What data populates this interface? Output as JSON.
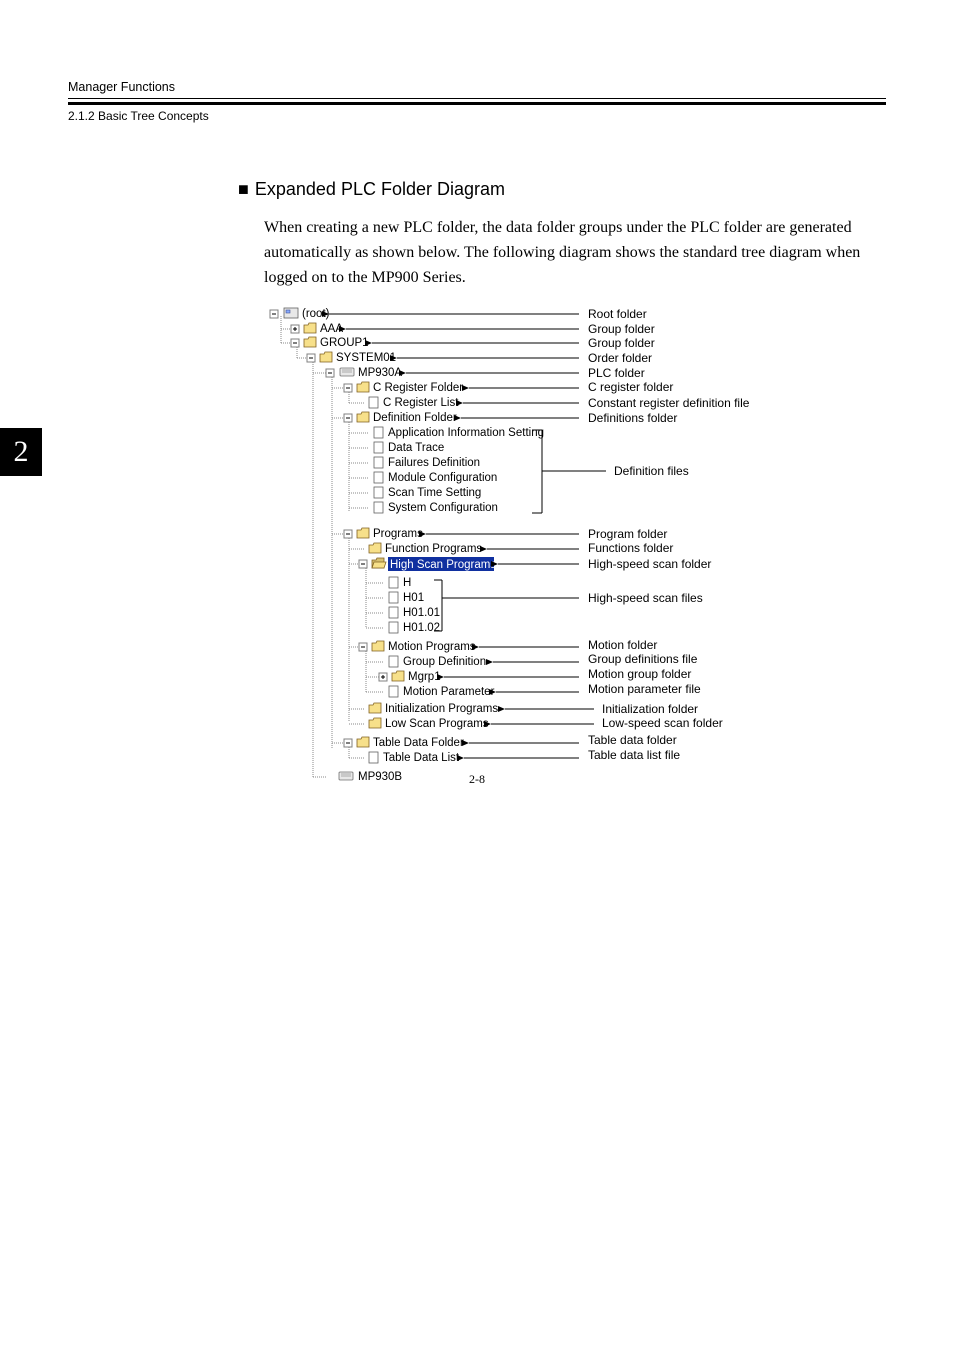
{
  "header": {
    "chapter_title": "Manager Functions",
    "section_number": "2.1.2  Basic Tree Concepts",
    "tab_number": "2"
  },
  "section": {
    "title": "Expanded PLC Folder Diagram",
    "body": "When creating a new PLC folder, the data folder groups under the PLC folder are generated automatically as shown below. The following diagram shows the standard tree diagram when logged on to the MP900 Series."
  },
  "tree": {
    "n0": "(root)",
    "n1": "AAA",
    "n2": "GROUP1",
    "n3": "SYSTEM01",
    "n4": "MP930A",
    "n5": "C Register Folder",
    "n6": "C Register List",
    "n7": "Definition Folder",
    "n8": "Application Information Setting",
    "n9": "Data Trace",
    "n10": "Failures Definition",
    "n11": "Module Configuration",
    "n12": "Scan Time Setting",
    "n13": "System Configuration",
    "n14": "Programs",
    "n15": "Function Programs",
    "n16": "High Scan Programs",
    "n17": "H",
    "n18": "H01",
    "n19": "H01.01",
    "n20": "H01.02",
    "n21": "Motion Programs",
    "n22": "Group Definition",
    "n23": "Mgrp1",
    "n24": "Motion Parameter",
    "n25": "Initialization Programs",
    "n26": "Low Scan Programs",
    "n27": "Table Data Folder",
    "n28": "Table Data List",
    "n29": "MP930B"
  },
  "labels": {
    "l0": "Root folder",
    "l1": "Group folder",
    "l2": "Group folder",
    "l3": "Order folder",
    "l4": "PLC folder",
    "l5": "C register folder",
    "l6": "Constant register definition file",
    "l7": "Definitions folder",
    "l10": "Definition files",
    "l14": "Program folder",
    "l15": "Functions folder",
    "l16": "High-speed scan folder",
    "l18": "High-speed scan files",
    "l21": "Motion folder",
    "l22": "Group definitions file",
    "l23": "Motion group folder",
    "l24": "Motion parameter file",
    "l25": "Initialization folder",
    "l26": "Low-speed scan folder",
    "l27": "Table data folder",
    "l28": "Table data list file"
  },
  "page_number": "2-8"
}
